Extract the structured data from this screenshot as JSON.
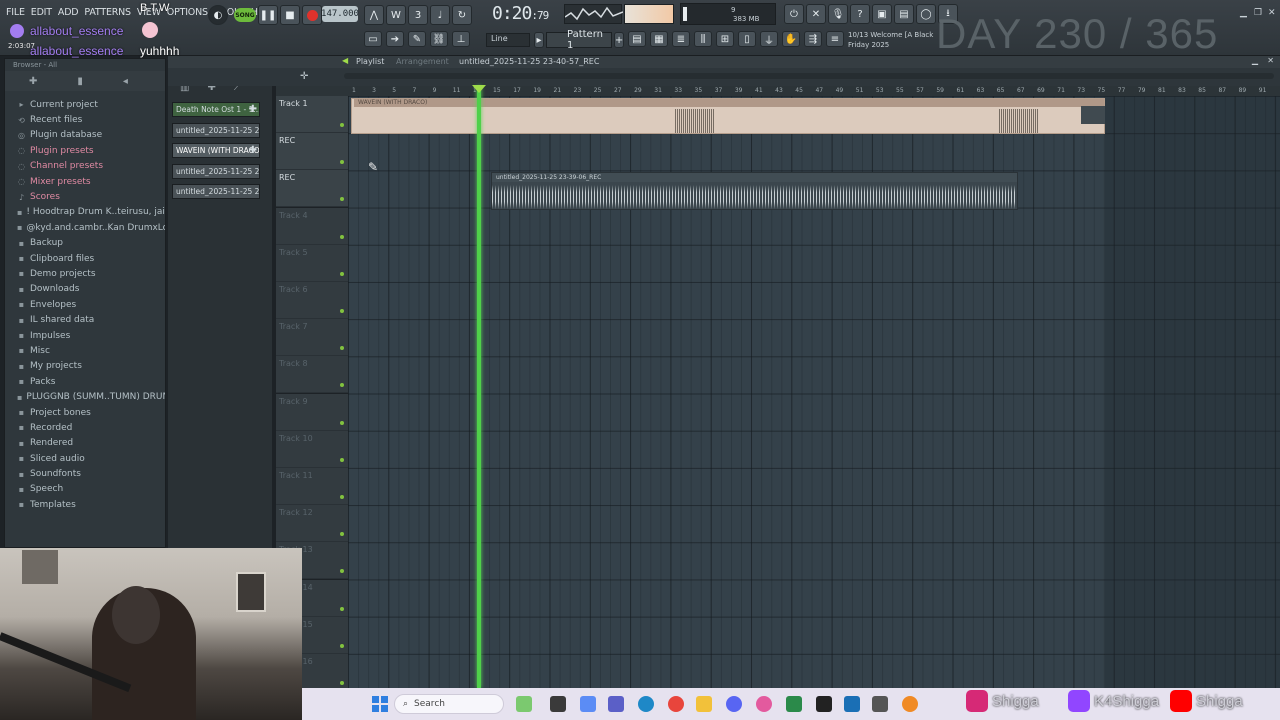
{
  "menu": [
    "FILE",
    "EDIT",
    "ADD",
    "PATTERNS",
    "VIEW",
    "OPTIONS",
    "TOOLS",
    "HELP"
  ],
  "chat": {
    "badge": "B.T.W",
    "user1": "allabout_essence",
    "user2": "allabout_essence",
    "message2": "yuhhhh",
    "time": "2:03:07"
  },
  "transport": {
    "song_label": "SONG",
    "tempo": "147.000",
    "time": "0:20",
    "time_small": ":79",
    "snap": "Line",
    "pattern": "Pattern 1"
  },
  "cpu": {
    "voices": "9",
    "memory": "383 MB",
    "poly": "0"
  },
  "news": {
    "line1": "10/13  Welcome [A Black",
    "line2": "Friday 2025"
  },
  "overlay": {
    "day": "DAY 230 / 365"
  },
  "browser": {
    "header": "Browser - All",
    "items": [
      {
        "label": "Current project",
        "icon": "project-icon"
      },
      {
        "label": "Recent files",
        "icon": "recent-icon"
      },
      {
        "label": "Plugin database",
        "icon": "plugin-icon"
      },
      {
        "label": "Plugin presets",
        "icon": "preset-icon"
      },
      {
        "label": "Channel presets",
        "icon": "preset-icon"
      },
      {
        "label": "Mixer presets",
        "icon": "preset-icon"
      },
      {
        "label": "Scores",
        "icon": "score-icon"
      },
      {
        "label": "! Hoodtrap Drum K..teirusu, jai) (2)",
        "icon": "folder-icon"
      },
      {
        "label": "@kyd.and.cambr..Kan DrumxLoopKit",
        "icon": "folder-icon"
      },
      {
        "label": "Backup",
        "icon": "folder-icon"
      },
      {
        "label": "Clipboard files",
        "icon": "folder-icon"
      },
      {
        "label": "Demo projects",
        "icon": "folder-icon"
      },
      {
        "label": "Downloads",
        "icon": "folder-icon"
      },
      {
        "label": "Envelopes",
        "icon": "folder-icon"
      },
      {
        "label": "IL shared data",
        "icon": "folder-icon"
      },
      {
        "label": "Impulses",
        "icon": "folder-icon"
      },
      {
        "label": "Misc",
        "icon": "folder-icon"
      },
      {
        "label": "My projects",
        "icon": "folder-icon"
      },
      {
        "label": "Packs",
        "icon": "folder-icon"
      },
      {
        "label": "PLUGGNB (SUMM..TUMN) DRUMKIT",
        "icon": "folder-icon"
      },
      {
        "label": "Project bones",
        "icon": "folder-icon"
      },
      {
        "label": "Recorded",
        "icon": "folder-icon"
      },
      {
        "label": "Rendered",
        "icon": "folder-icon"
      },
      {
        "label": "Sliced audio",
        "icon": "folder-icon"
      },
      {
        "label": "Soundfonts",
        "icon": "folder-icon"
      },
      {
        "label": "Speech",
        "icon": "folder-icon"
      },
      {
        "label": "Templates",
        "icon": "folder-icon"
      }
    ]
  },
  "picker": {
    "clips": [
      {
        "label": "Death Note Ost 1 - 1..."
      },
      {
        "label": "untitled_2025-11-25 23-..."
      },
      {
        "label": "WAVEIN (WITH DRACO)"
      },
      {
        "label": "untitled_2025-11-25 23-..."
      },
      {
        "label": "untitled_2025-11-25 23-..."
      }
    ]
  },
  "playlist": {
    "title": "Playlist",
    "subtitle": "Arrangement",
    "project": "untitled_2025-11-25 23-40-57_REC",
    "tracks": [
      "Track 1",
      "REC",
      "REC",
      "Track 4",
      "Track 5",
      "Track 6",
      "Track 7",
      "Track 8",
      "Track 9",
      "Track 10",
      "Track 11",
      "Track 12",
      "Track 13",
      "Track 14",
      "Track 15",
      "Track 16"
    ],
    "timeline": [
      "1",
      "3",
      "5",
      "7",
      "9",
      "11",
      "13",
      "15",
      "17",
      "19",
      "21",
      "23",
      "25",
      "27",
      "29",
      "31",
      "33",
      "35",
      "37",
      "39",
      "41",
      "43",
      "45",
      "47",
      "49",
      "51",
      "53",
      "55",
      "57",
      "59",
      "61",
      "63",
      "65",
      "67",
      "69",
      "71",
      "73",
      "75",
      "77",
      "79",
      "81",
      "83",
      "85",
      "87",
      "89",
      "91"
    ],
    "clip1": "WAVEIN (WITH DRACO)",
    "clip2": "untitled_2025-11-25 23-39-06_REC"
  },
  "taskbar": {
    "search_placeholder": "Search",
    "socials": [
      {
        "name": "Shigga",
        "icon": "instagram-icon",
        "color": "#d62976"
      },
      {
        "name": "K4Shigga",
        "icon": "twitch-icon",
        "color": "#9146ff"
      },
      {
        "name": "Shigga",
        "icon": "youtube-icon",
        "color": "#ff0000"
      }
    ]
  },
  "colors": {
    "playhead": "#4fd04a",
    "record": "#e0322c",
    "song_mode": "#6dbb3c"
  }
}
